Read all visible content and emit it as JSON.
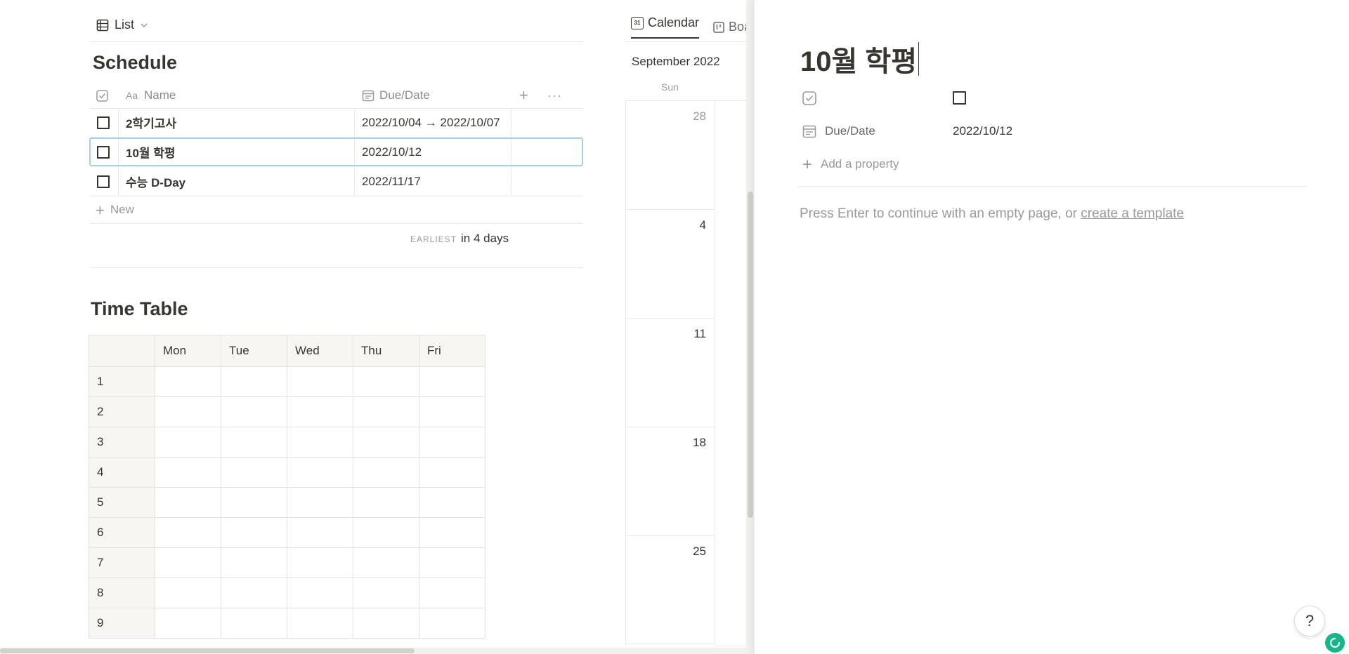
{
  "list_view": {
    "label": "List"
  },
  "schedule": {
    "title": "Schedule",
    "columns": {
      "name": "Name",
      "due": "Due/Date"
    },
    "rows": [
      {
        "name": "2학기고사",
        "due": "2022/10/04 → 2022/10/07"
      },
      {
        "name": "10월 학평",
        "due": "2022/10/12"
      },
      {
        "name": "수능 D-Day",
        "due": "2022/11/17"
      }
    ],
    "new_label": "New",
    "footer": {
      "label": "EARLIEST",
      "value": "in 4 days"
    }
  },
  "timetable": {
    "title": "Time Table",
    "days": [
      "Mon",
      "Tue",
      "Wed",
      "Thu",
      "Fri"
    ],
    "periods": [
      "1",
      "2",
      "3",
      "4",
      "5",
      "6",
      "7",
      "8",
      "9"
    ]
  },
  "calendar": {
    "tabs": [
      "Calendar",
      "Boa"
    ],
    "month": "September 2022",
    "weekday": "Sun",
    "days": [
      "28",
      "4",
      "11",
      "18",
      "25"
    ],
    "tab_icon_text": "31"
  },
  "peek": {
    "title": "10월 학평",
    "prop_due_label": "Due/Date",
    "prop_due_value": "2022/10/12",
    "add_property": "Add a property",
    "empty_text": "Press Enter to continue with an empty page, or ",
    "template_link": "create a template"
  },
  "help": {
    "label": "?"
  }
}
